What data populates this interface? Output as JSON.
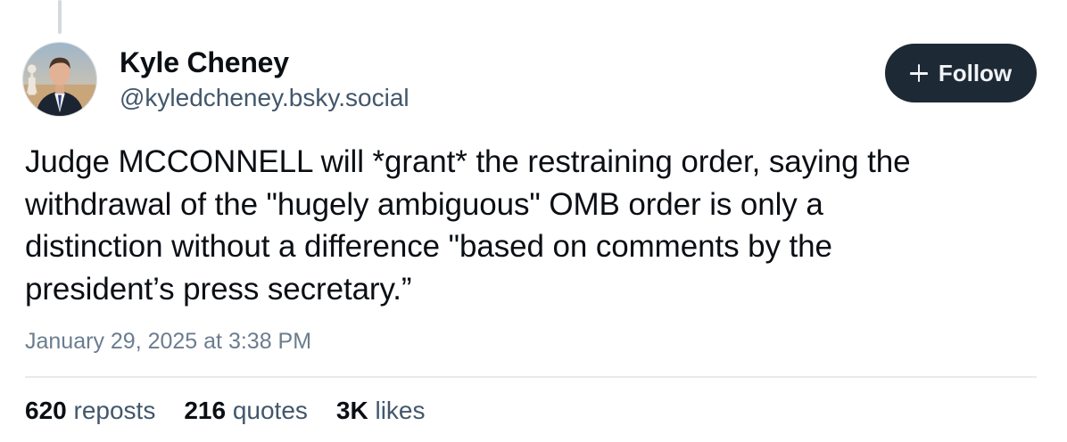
{
  "post": {
    "author": {
      "name": "Kyle Cheney",
      "handle": "@kyledcheney.bsky.social",
      "avatar_icon": "profile-photo"
    },
    "follow_button": {
      "label": "Follow",
      "icon": "plus-icon"
    },
    "text": "Judge MCCONNELL will *grant* the restraining order, saying the\nwithdrawal of the \"hugely ambiguous\" OMB order is only a\ndistinction without a difference \"based on comments by the\npresident’s press secretary.”",
    "timestamp": "January 29, 2025 at 3:38 PM",
    "stats": {
      "reposts": {
        "count": "620",
        "label": "reposts"
      },
      "quotes": {
        "count": "216",
        "label": "quotes"
      },
      "likes": {
        "count": "3K",
        "label": "likes"
      }
    }
  },
  "colors": {
    "text_primary": "#0b0f14",
    "text_secondary": "#42576c",
    "timestamp": "#6b7d8f",
    "follow_button_bg": "#1e2936",
    "divider": "#e7eaee"
  }
}
